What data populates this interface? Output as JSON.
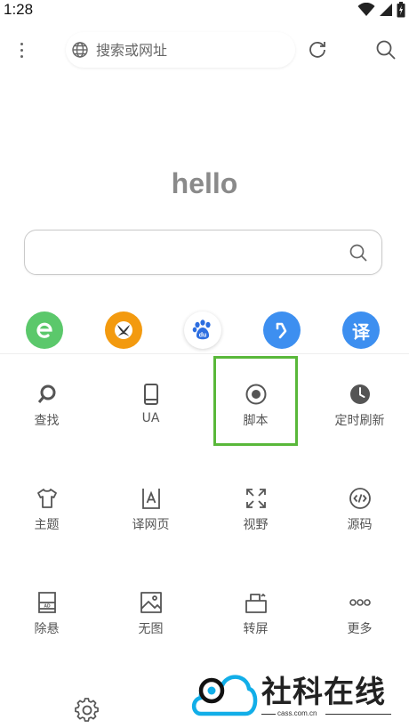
{
  "status_bar": {
    "time": "1:28"
  },
  "toolbar": {
    "url_placeholder": "搜索或网址"
  },
  "home": {
    "title": "hello"
  },
  "shortcuts": [
    {
      "icon": "e-browser-icon",
      "color": "#5bc86b"
    },
    {
      "icon": "xbox-icon",
      "color": "#f39a0f"
    },
    {
      "icon": "baidu-icon",
      "color": "#ffffff"
    },
    {
      "icon": "back-arrow-icon",
      "color": "#3d8ff0"
    },
    {
      "icon": "translate-icon",
      "color": "#3d8ff0",
      "text": "译"
    }
  ],
  "menu": [
    {
      "label": "查找",
      "icon": "find-icon"
    },
    {
      "label": "UA",
      "icon": "phone-icon"
    },
    {
      "label": "脚本",
      "icon": "record-icon"
    },
    {
      "label": "定时刷新",
      "icon": "clock-icon"
    },
    {
      "label": "主题",
      "icon": "tshirt-icon"
    },
    {
      "label": "译网页",
      "icon": "translate-page-icon"
    },
    {
      "label": "视野",
      "icon": "expand-icon"
    },
    {
      "label": "源码",
      "icon": "code-icon"
    },
    {
      "label": "除悬",
      "icon": "remove-float-icon"
    },
    {
      "label": "无图",
      "icon": "image-icon"
    },
    {
      "label": "转屏",
      "icon": "rotate-icon"
    },
    {
      "label": "更多",
      "icon": "more-icon"
    }
  ],
  "colors": {
    "highlight": "#59b83a",
    "accent_blue": "#3d8ff0"
  },
  "watermark": {
    "brand": "社科在线",
    "domain": "cass.com.cn"
  }
}
